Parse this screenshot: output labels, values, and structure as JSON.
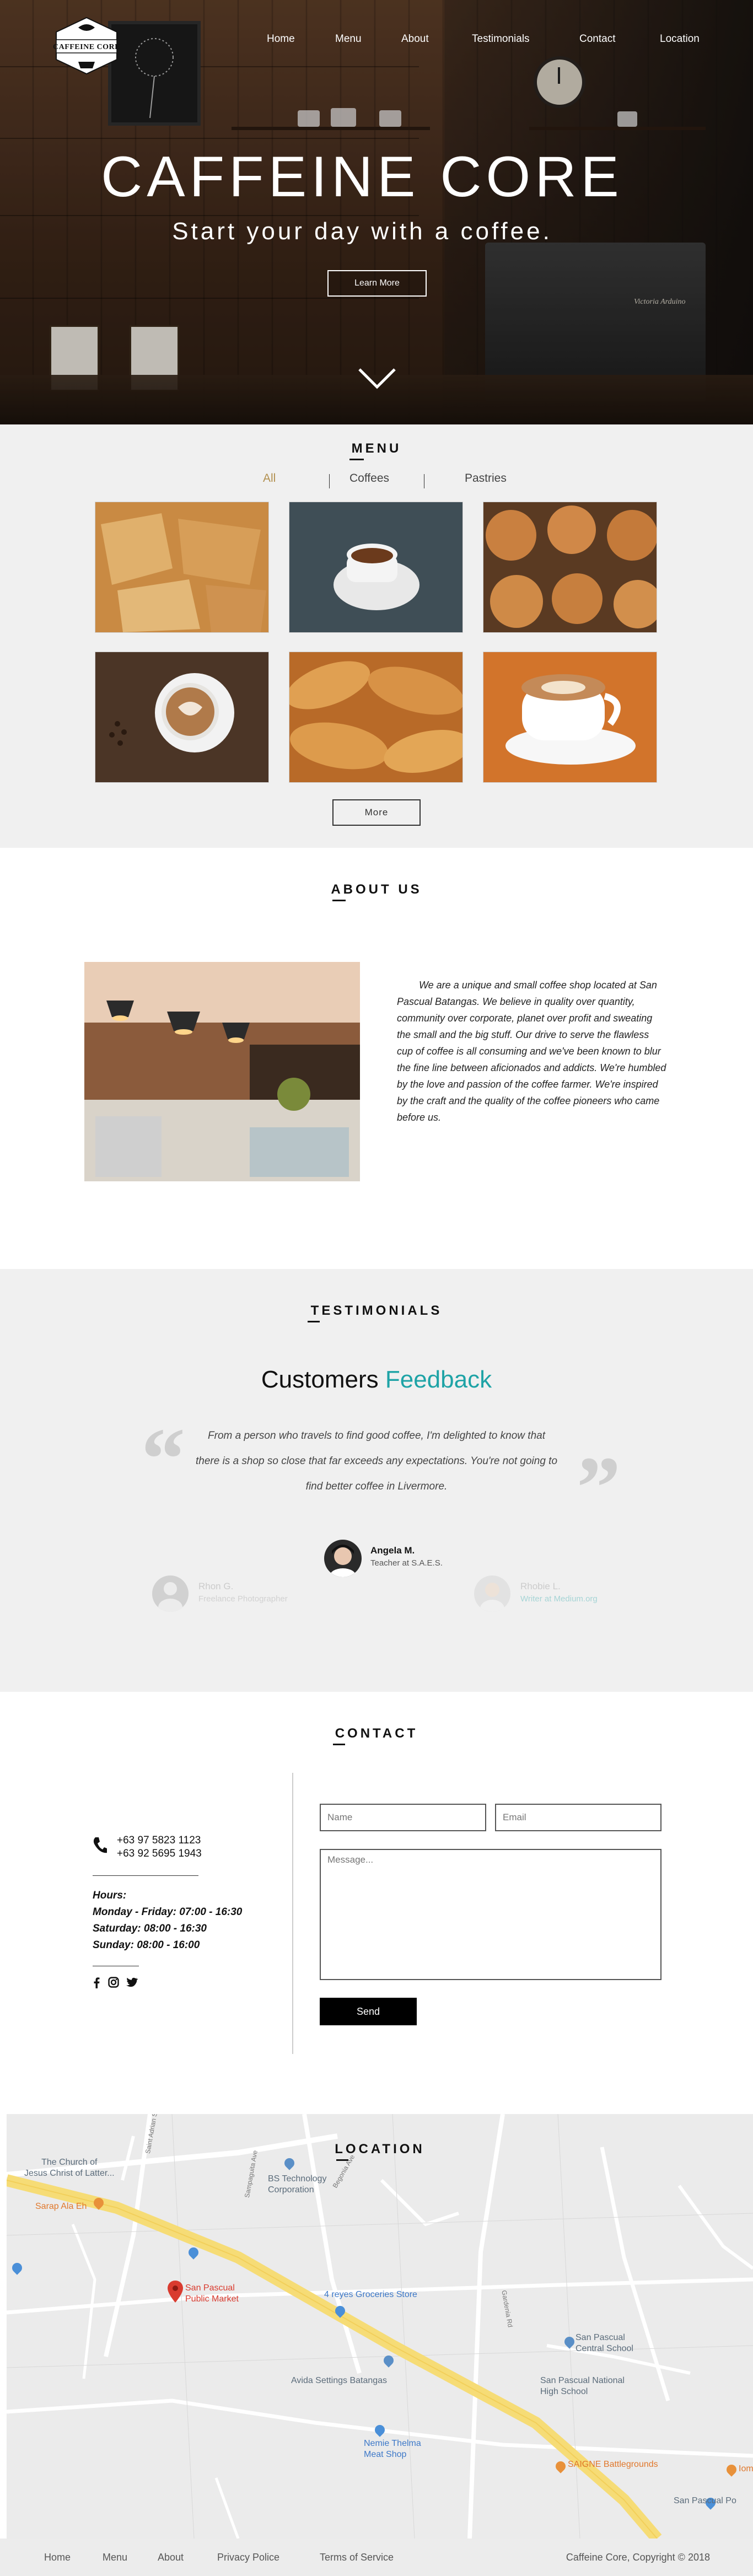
{
  "brand": {
    "logo_text": "CAFFEINE CORE"
  },
  "nav": {
    "items": [
      "Home",
      "Menu",
      "About",
      "Testimonials",
      "Contact",
      "Location"
    ]
  },
  "hero": {
    "title": "CAFFEINE CORE",
    "subtitle": "Start your day with a coffee.",
    "cta_label": "Learn More",
    "machine_brand": "Victoria Arduino",
    "scroll_icon": "chevron-down-icon"
  },
  "menu": {
    "title": "MENU",
    "filters": [
      "All",
      "Coffees",
      "Pastries"
    ],
    "active_filter": "All",
    "more_label": "More",
    "items": [
      {
        "name": "scones",
        "color": "#c98a43"
      },
      {
        "name": "espresso",
        "color": "#3f4e56"
      },
      {
        "name": "muffins",
        "color": "#b76a33"
      },
      {
        "name": "latte-art",
        "color": "#4b3526"
      },
      {
        "name": "croissants",
        "color": "#d08a3c"
      },
      {
        "name": "cappuccino",
        "color": "#d2742b"
      }
    ]
  },
  "about": {
    "title": "ABOUT US",
    "text": "We are a unique and small coffee shop located at San Pascual Batangas. We believe in quality over quantity, community over corporate, planet over profit and sweating the small and the big stuff. Our drive to serve the flawless cup of coffee is all consuming and we've been known to blur the fine line between aficionados and addicts. We're humbled by the love and passion of the coffee farmer. We're inspired by the craft and the quality of the coffee pioneers who came before us."
  },
  "testimonials": {
    "title": "TESTIMONIALS",
    "heading_main": "Customers",
    "heading_accent": "Feedback",
    "accent_color": "#1ea3a6",
    "quote": "From a person who travels to find good coffee, I'm delighted to know that there is a shop so close that far exceeds any expectations. You're not going to find better coffee in Livermore.",
    "people": [
      {
        "name": "Rhon G.",
        "role": "Freelance Photographer"
      },
      {
        "name": "Angela M.",
        "role": "Teacher at S.A.E.S."
      },
      {
        "name": "Rhobie L.",
        "role": "Writer at Medium.org"
      }
    ]
  },
  "contact": {
    "title": "CONTACT",
    "phones": [
      "+63 97 5823 1123",
      "+63 92 5695 1943"
    ],
    "hours_label": "Hours:",
    "hours": [
      "Monday - Friday: 07:00 - 16:30",
      "Saturday: 08:00 - 16:30",
      "Sunday: 08:00 - 16:00"
    ],
    "form": {
      "name_placeholder": "Name",
      "email_placeholder": "Email",
      "message_placeholder": "Message...",
      "send_label": "Send"
    }
  },
  "location": {
    "title": "LOCATION",
    "places": [
      {
        "label": "The Church of\nJesus Christ of Latter...",
        "kind": "poi"
      },
      {
        "label": "Sarap Ala Eh",
        "kind": "food"
      },
      {
        "label": "BS Technology\nCorporation",
        "kind": "poi"
      },
      {
        "label": "San Pascual\nPublic Market",
        "kind": "marker"
      },
      {
        "label": "4 reyes Groceries Store",
        "kind": "shop"
      },
      {
        "label": "Avida Settings Batangas",
        "kind": "poi"
      },
      {
        "label": "San Pascual\nCentral School",
        "kind": "poi"
      },
      {
        "label": "San Pascual National\nHigh School",
        "kind": "poi"
      },
      {
        "label": "Nemie Thelma\nMeat Shop",
        "kind": "shop"
      },
      {
        "label": "SAIGNE Battlegrounds",
        "kind": "food"
      },
      {
        "label": "San Pascual Po",
        "kind": "poi"
      },
      {
        "label": "Iomi",
        "kind": "food"
      }
    ],
    "streets": [
      "Saint Adrian St",
      "Sampaguita Ave",
      "Begonia Ave",
      "Gardenia Rd"
    ]
  },
  "footer": {
    "links": [
      "Home",
      "Menu",
      "About",
      "Privacy Police",
      "Terms of Service"
    ],
    "copyright": "Caffeine Core, Copyright © 2018"
  }
}
